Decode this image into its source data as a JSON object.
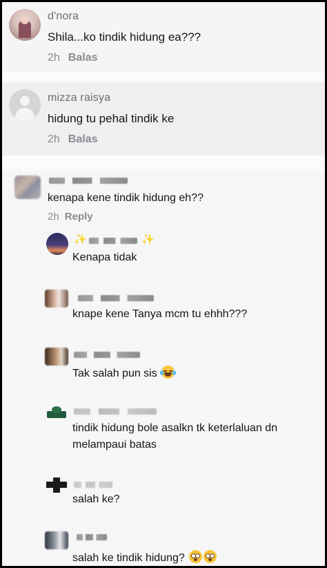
{
  "comments": [
    {
      "name": "d'nora",
      "text": "Shila...ko tindik hidung ea???",
      "time": "2h",
      "reply": "Balas"
    },
    {
      "name": "mizza raisya",
      "text": "hidung tu pehal tindik ke",
      "time": "2h",
      "reply": "Balas"
    },
    {
      "name": "",
      "text": "kenapa kene tindik hidung eh??",
      "time": "2h",
      "reply": "Reply"
    }
  ],
  "replies": [
    {
      "name_decor": "✨",
      "text": "Kenapa tidak"
    },
    {
      "text": "knape kene Tanya mcm tu ehhh???"
    },
    {
      "text": "Tak salah pun sis",
      "emoji": "laugh-tears-emoji"
    },
    {
      "text_line1": "tindik hidung bole asalkn tk keterlaluan dn",
      "text_line2": "melampaui batas"
    },
    {
      "text": "salah ke?"
    },
    {
      "text": "salah ke tindik hidung?",
      "emoji": "flushed-emoji"
    }
  ],
  "icons": {
    "default_avatar": "person-placeholder-icon"
  }
}
